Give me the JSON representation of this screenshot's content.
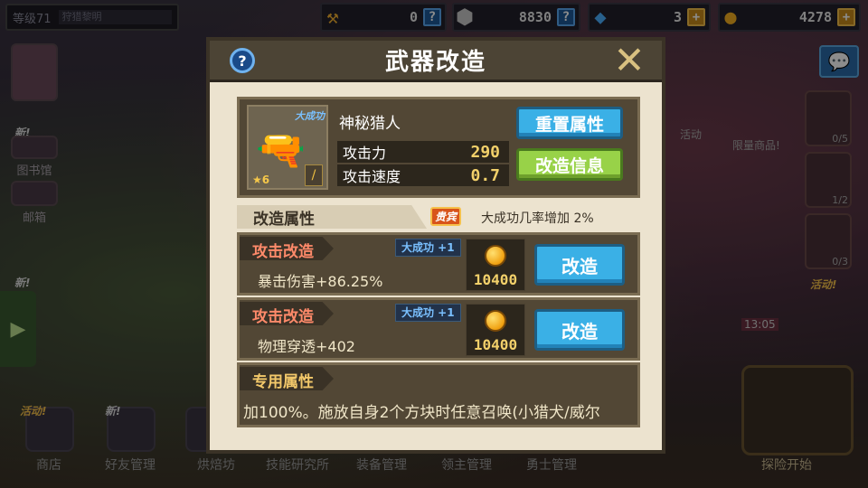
{
  "hud": {
    "level_label": "等级71",
    "level_sub": "狩猎黎明",
    "currencies": [
      {
        "icon": "hammer-icon",
        "value": "0",
        "action": "?"
      },
      {
        "icon": "ore-icon",
        "value": "8830",
        "action": "?"
      },
      {
        "icon": "diamond-icon",
        "value": "3",
        "action": "+"
      },
      {
        "icon": "coin-icon",
        "value": "4278",
        "action": "+"
      }
    ]
  },
  "background": {
    "left_items": [
      "图书馆",
      "邮箱"
    ],
    "new_tag": "新!",
    "bottom_items": [
      "商店",
      "好友管理",
      "烘焙坊",
      "技能研究所",
      "装备管理",
      "领主管理",
      "勇士管理",
      "探险开始"
    ],
    "right_counts": [
      "0/5",
      "1/2",
      "0/3"
    ],
    "right_labels": [
      "活动",
      "限量商品!"
    ],
    "right_timer": "13:05",
    "activity_tag": "活动!"
  },
  "modal": {
    "title": "武器改造",
    "help": "?",
    "close": "✕",
    "weapon": {
      "name": "神秘猎人",
      "great_success_tag": "大成功",
      "stars": "6",
      "stats": [
        {
          "label": "攻击力",
          "value": "290"
        },
        {
          "label": "攻击速度",
          "value": "0.7"
        }
      ],
      "reset_button": "重置属性",
      "info_button": "改造信息"
    },
    "attributes": {
      "title": "改造属性",
      "vip_badge": "贵宾",
      "vip_bonus": "大成功几率增加 2%"
    },
    "mods": [
      {
        "label": "攻击改造",
        "crit": "大成功 +1",
        "desc": "暴击伤害+86.25%",
        "cost": "10400",
        "button": "改造"
      },
      {
        "label": "攻击改造",
        "crit": "大成功 +1",
        "desc": "物理穿透+402",
        "cost": "10400",
        "button": "改造"
      }
    ],
    "exclusive": {
      "label": "专用属性",
      "text": "加100%。施放自身2个方块时任意召唤(小猎犬/威尔"
    }
  }
}
